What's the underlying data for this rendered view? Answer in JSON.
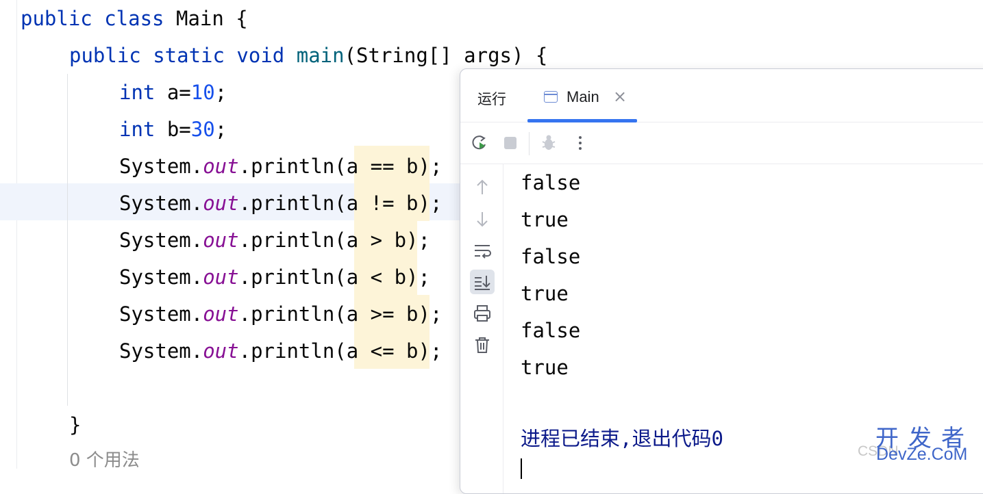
{
  "editor": {
    "lines": [
      [
        {
          "t": "public class ",
          "c": "kw"
        },
        {
          "t": "Main {",
          "c": ""
        }
      ],
      [
        {
          "t": "public static void ",
          "c": "kw"
        },
        {
          "t": "main",
          "c": "fn"
        },
        {
          "t": "(String[] args) {",
          "c": ""
        }
      ],
      [
        {
          "t": "int ",
          "c": "kw"
        },
        {
          "t": "a=",
          "c": ""
        },
        {
          "t": "10",
          "c": "num"
        },
        {
          "t": ";",
          "c": ""
        }
      ],
      [
        {
          "t": "int ",
          "c": "kw"
        },
        {
          "t": "b=",
          "c": ""
        },
        {
          "t": "30",
          "c": "num"
        },
        {
          "t": ";",
          "c": ""
        }
      ],
      [
        {
          "t": "System.",
          "c": ""
        },
        {
          "t": "out",
          "c": "fld"
        },
        {
          "t": ".println(a == b);",
          "c": ""
        }
      ],
      [
        {
          "t": "System.",
          "c": ""
        },
        {
          "t": "out",
          "c": "fld"
        },
        {
          "t": ".println(a != b);",
          "c": ""
        }
      ],
      [
        {
          "t": "System.",
          "c": ""
        },
        {
          "t": "out",
          "c": "fld"
        },
        {
          "t": ".println(a > b);",
          "c": ""
        }
      ],
      [
        {
          "t": "System.",
          "c": ""
        },
        {
          "t": "out",
          "c": "fld"
        },
        {
          "t": ".println(a < b);",
          "c": ""
        }
      ],
      [
        {
          "t": "System.",
          "c": ""
        },
        {
          "t": "out",
          "c": "fld"
        },
        {
          "t": ".println(a >= b);",
          "c": ""
        }
      ],
      [
        {
          "t": "System.",
          "c": ""
        },
        {
          "t": "out",
          "c": "fld"
        },
        {
          "t": ".println(a <= b);",
          "c": ""
        }
      ],
      [
        {
          "t": "",
          "c": ""
        }
      ],
      [
        {
          "t": "}",
          "c": ""
        }
      ]
    ],
    "usage_hint": "0 个用法"
  },
  "run_window": {
    "tab_run_label": "运行",
    "tab_main_label": "Main",
    "tab_close_glyph": "×",
    "toolbar_icons": [
      "rerun-icon",
      "stop-icon",
      "debug-icon",
      "more-icon"
    ],
    "sidebar_icons": [
      "up-arrow-icon",
      "down-arrow-icon",
      "soft-wrap-icon",
      "scroll-to-end-icon",
      "print-icon",
      "trash-icon"
    ],
    "output_lines": [
      "false",
      "true",
      "false",
      "true",
      "false",
      "true"
    ],
    "exit_message": "进程已结束,退出代码0"
  },
  "watermark": {
    "cn": "开发者",
    "en": "DevZe.CoM",
    "csdn": "CSDN"
  },
  "colors": {
    "keyword": "#0033b3",
    "method": "#00627a",
    "number": "#1750eb",
    "field": "#871094",
    "accent": "#3574f0"
  }
}
